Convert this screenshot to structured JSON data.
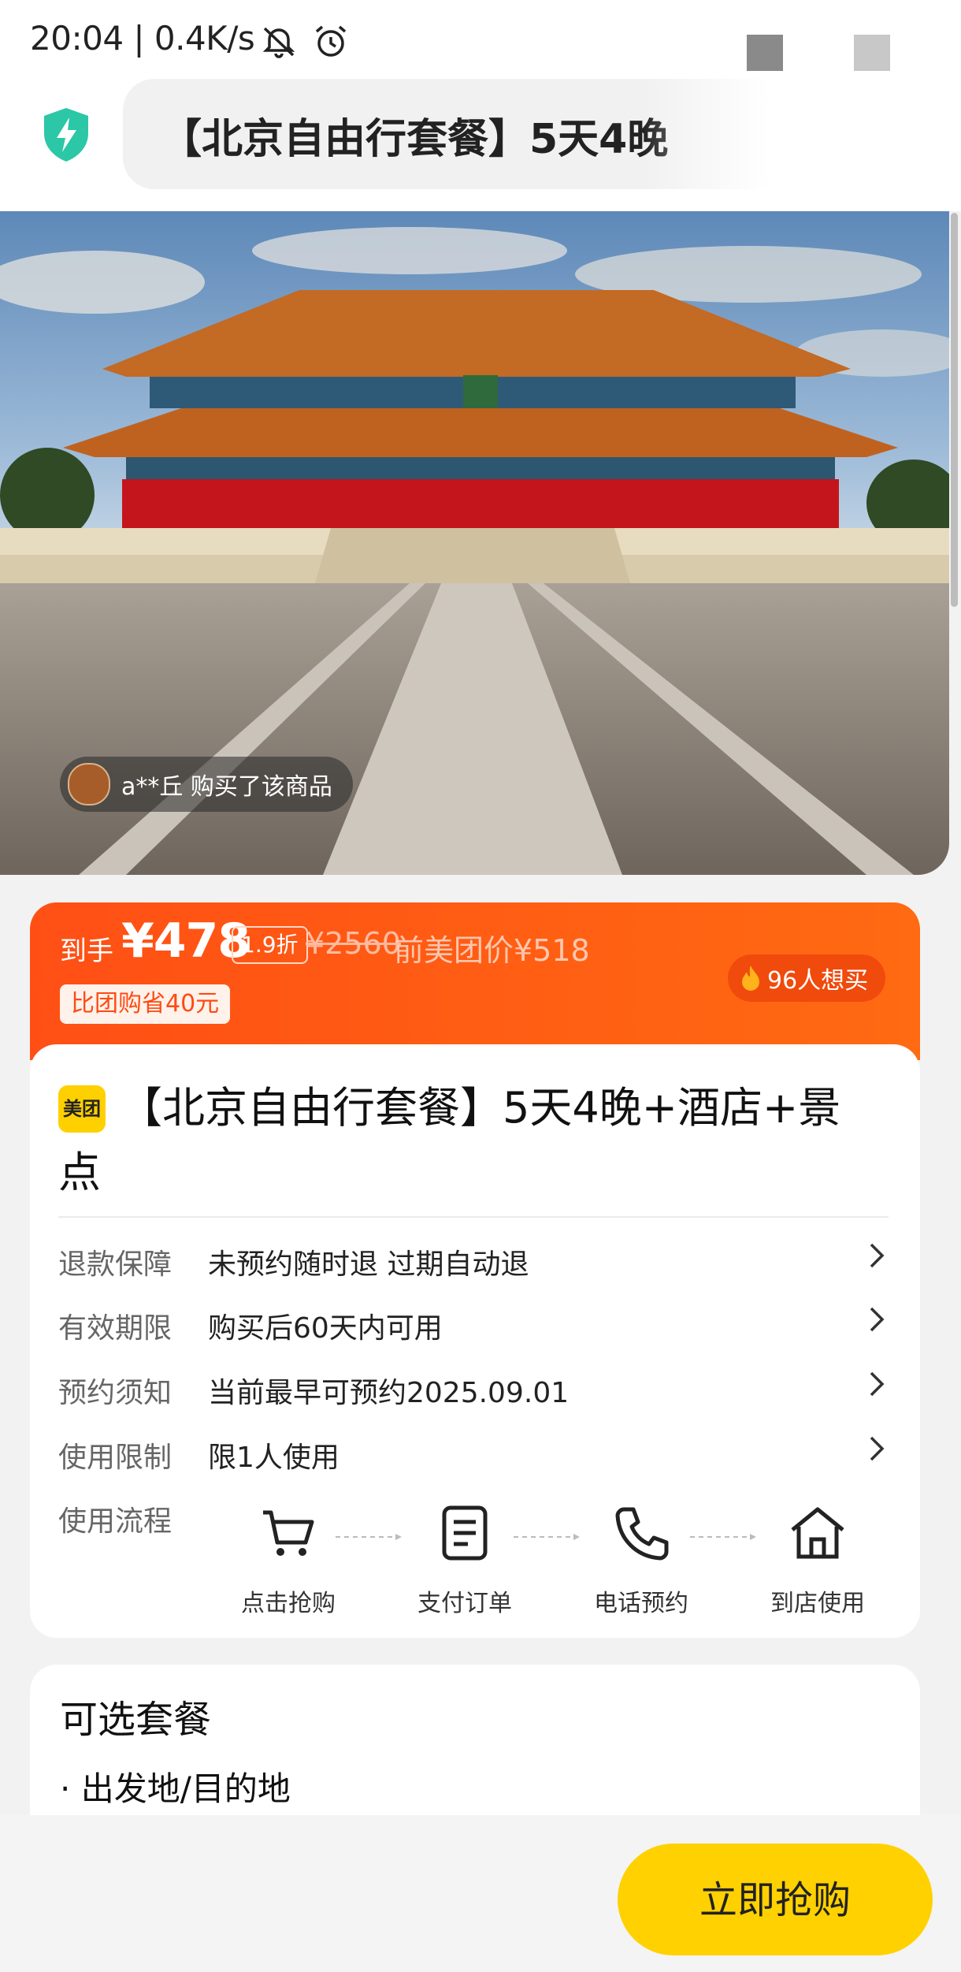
{
  "status_bar": {
    "time": "20:04 | 0.4K/s",
    "icons": [
      "mute-icon",
      "alarm-icon",
      "signal-icon",
      "battery-icon"
    ]
  },
  "header": {
    "title": "【北京自由行套餐】5天4晚",
    "icon": "shield-lightning-icon",
    "accent_color": "#2bc7a6"
  },
  "hero": {
    "buyer_notice": "a**丘 购买了该商品"
  },
  "price": {
    "prefix": "到手",
    "amount": "¥478",
    "discount": "1.9折",
    "original": "¥2560",
    "reference": "前美团价¥518",
    "savings": "比团购省40元",
    "wants": "96人想买",
    "banner_color": "#ff5414"
  },
  "product": {
    "brand_badge": "美团",
    "title": "【北京自由行套餐】5天4晚+酒店+景点",
    "rows": [
      {
        "label": "退款保障",
        "value": "未预约随时退 过期自动退"
      },
      {
        "label": "有效期限",
        "value": "购买后60天内可用"
      },
      {
        "label": "预约须知",
        "value": "当前最早可预约2025.09.01"
      },
      {
        "label": "使用限制",
        "value": "限1人使用"
      }
    ],
    "process_label": "使用流程",
    "steps": [
      {
        "label": "点击抢购",
        "icon": "cart-icon"
      },
      {
        "label": "支付订单",
        "icon": "document-icon"
      },
      {
        "label": "电话预约",
        "icon": "phone-icon"
      },
      {
        "label": "到店使用",
        "icon": "home-icon"
      }
    ]
  },
  "options": {
    "title": "可选套餐",
    "item": "出发地/目的地"
  },
  "bottom_bar": {
    "buy_label": "立即抢购",
    "button_color": "#ffd100"
  }
}
